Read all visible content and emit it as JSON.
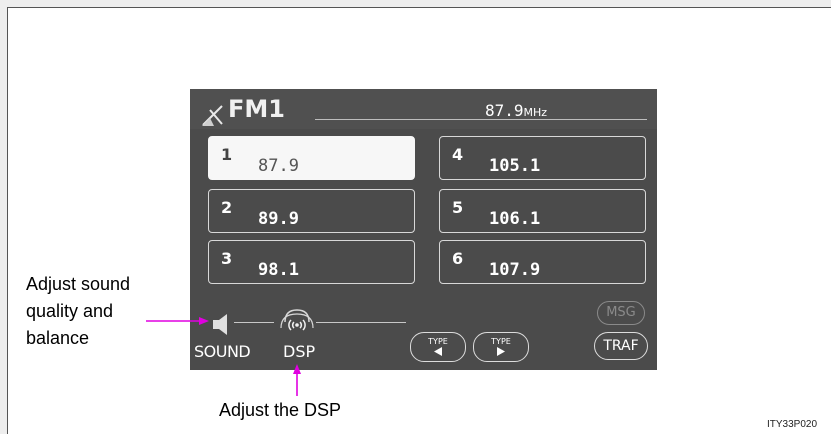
{
  "header": {
    "band": "FM1",
    "frequency": "87.9",
    "unit": "MHz"
  },
  "presets": [
    {
      "number": "1",
      "value": "87.9"
    },
    {
      "number": "2",
      "value": "89.9"
    },
    {
      "number": "3",
      "value": "98.1"
    },
    {
      "number": "4",
      "value": "105.1"
    },
    {
      "number": "5",
      "value": "106.1"
    },
    {
      "number": "6",
      "value": "107.9"
    }
  ],
  "selected_preset": "1",
  "controls": {
    "sound_label": "SOUND",
    "dsp_label": "DSP",
    "type_label": "TYPE",
    "msg_label": "MSG",
    "traf_label": "TRAF"
  },
  "callouts": {
    "sound_line1": "Adjust sound",
    "sound_line2": "quality and",
    "sound_line3": "balance",
    "dsp": "Adjust the DSP"
  },
  "figure_code": "ITY33P020",
  "colors": {
    "arrow": "#e000e0",
    "screen": "#4b4b4b",
    "selected_preset": "#f7f7f7"
  },
  "icons": [
    "antenna-icon",
    "speaker-icon",
    "dsp-wave-icon",
    "triangle-left-icon",
    "triangle-right-icon"
  ]
}
